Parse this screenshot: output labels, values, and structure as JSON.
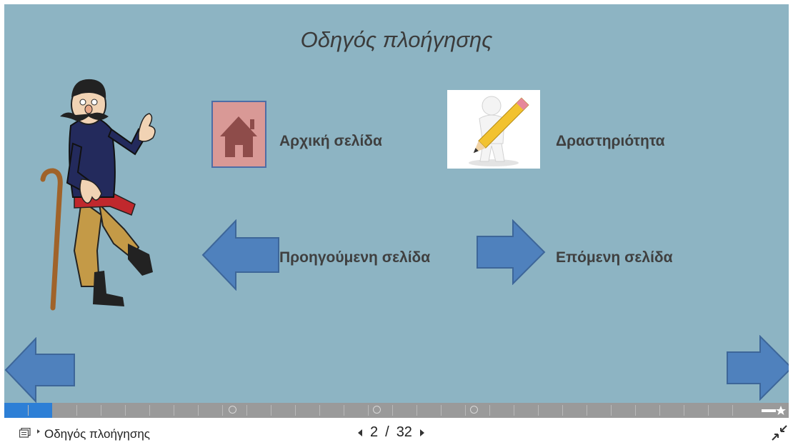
{
  "slide": {
    "title": "Οδηγός πλοήγησης",
    "home_label": "Αρχική σελίδα",
    "activity_label": "Δραστηριότητα",
    "previous_label": "Προηγούμενη σελίδα",
    "next_label": "Επόμενη σελίδα"
  },
  "colors": {
    "slide_background": "#8db4c3",
    "arrow_fill": "#4f81bd",
    "home_box": "#d99996",
    "progress_fill": "#2d7fd6"
  },
  "icons": {
    "character": "cartoon-man-with-cane",
    "home": "house-icon",
    "activity": "pencil-figure-icon",
    "prev": "left-arrow-icon",
    "next": "right-arrow-icon"
  },
  "progress": {
    "current": 2,
    "total": 32
  },
  "footer": {
    "toc_label": "Οδηγός πλοήγησης",
    "current_page": "2",
    "separator": "/",
    "total_pages": "32"
  }
}
